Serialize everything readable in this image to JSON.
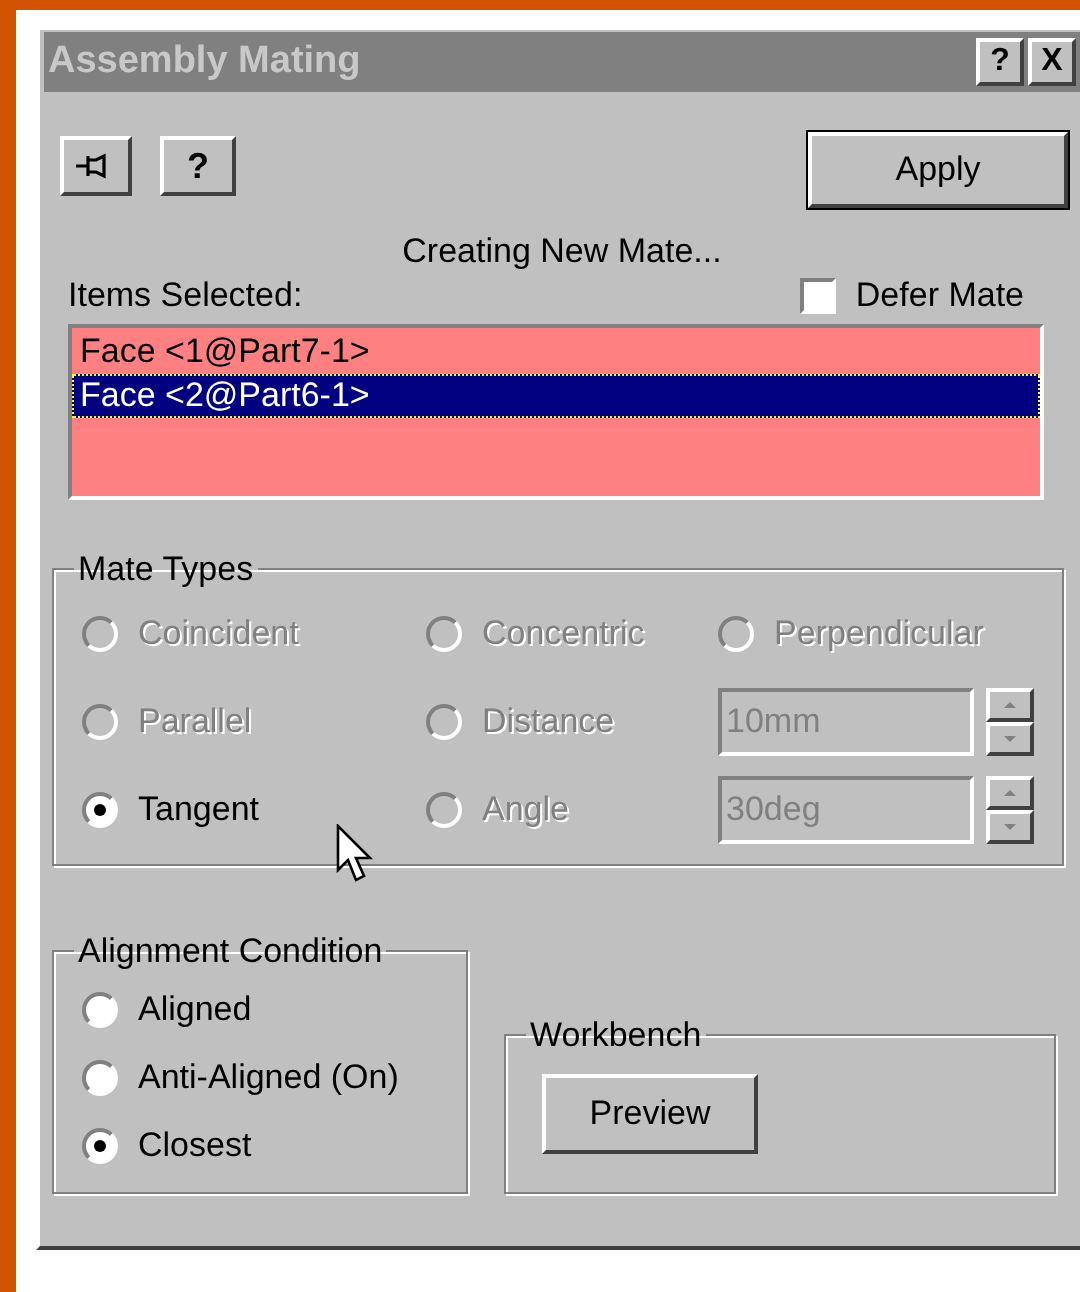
{
  "window": {
    "title": "Assembly Mating",
    "title_buttons": [
      "?",
      "X"
    ]
  },
  "toolbar": {
    "help_button": "?",
    "apply_button": "Apply"
  },
  "status": "Creating New Mate...",
  "items_label": "Items Selected:",
  "defer_mate": {
    "label": "Defer Mate",
    "checked": false
  },
  "items": [
    {
      "label": "Face <1@Part7-1>",
      "selected": false
    },
    {
      "label": "Face <2@Part6-1>",
      "selected": true
    }
  ],
  "mate_types": {
    "title": "Mate Types",
    "options": [
      {
        "kind": "radio",
        "label": "Coincident",
        "selected": false,
        "disabled": true
      },
      {
        "kind": "radio",
        "label": "Concentric",
        "selected": false,
        "disabled": true
      },
      {
        "kind": "radio",
        "label": "Perpendicular",
        "selected": false,
        "disabled": true
      },
      {
        "kind": "radio",
        "label": "Parallel",
        "selected": false,
        "disabled": true
      },
      {
        "kind": "radio",
        "label": "Distance",
        "selected": false,
        "disabled": true
      },
      {
        "kind": "field",
        "value": "10mm",
        "disabled": true
      },
      {
        "kind": "radio",
        "label": "Tangent",
        "selected": true,
        "disabled": false
      },
      {
        "kind": "radio",
        "label": "Angle",
        "selected": false,
        "disabled": true
      },
      {
        "kind": "field",
        "value": "30deg",
        "disabled": true
      }
    ]
  },
  "alignment": {
    "title": "Alignment Condition",
    "options": [
      {
        "label": "Aligned",
        "selected": false
      },
      {
        "label": "Anti-Aligned (On)",
        "selected": false
      },
      {
        "label": "Closest",
        "selected": true
      }
    ]
  },
  "workbench": {
    "title": "Workbench",
    "preview_button": "Preview"
  }
}
